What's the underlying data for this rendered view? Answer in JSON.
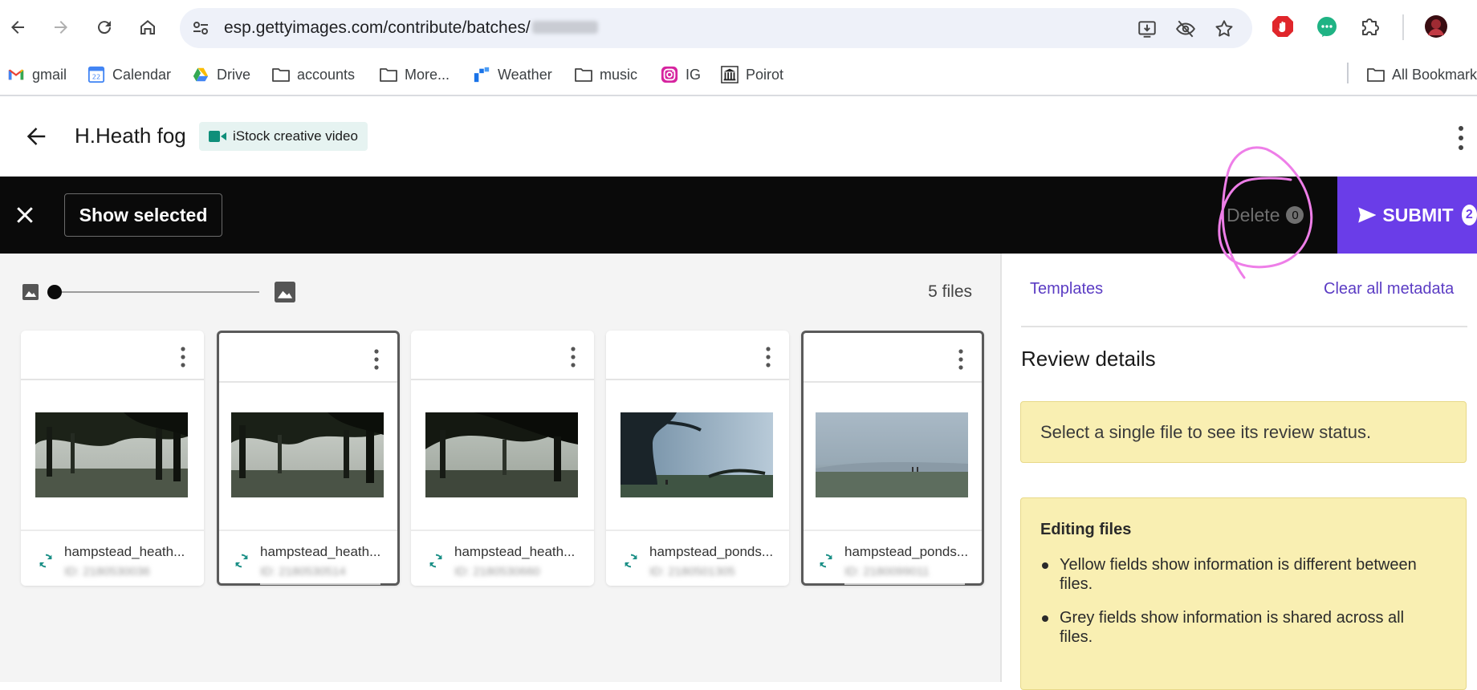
{
  "browser": {
    "url": "esp.gettyimages.com/contribute/batches/",
    "bookmarks": [
      {
        "label": "gmail",
        "icon": "gmail-icon"
      },
      {
        "label": "Calendar",
        "icon": "calendar-icon",
        "badge": "22"
      },
      {
        "label": "Drive",
        "icon": "drive-icon"
      },
      {
        "label": "accounts",
        "icon": "folder-icon"
      },
      {
        "label": "More...",
        "icon": "folder-icon"
      },
      {
        "label": "Weather",
        "icon": "weather-icon"
      },
      {
        "label": "music",
        "icon": "folder-icon"
      },
      {
        "label": "IG",
        "icon": "instagram-icon"
      },
      {
        "label": "Poirot",
        "icon": "museum-icon"
      }
    ],
    "all_bookmarks": "All Bookmarks"
  },
  "header": {
    "title": "H.Heath fog",
    "chip": "iStock creative video"
  },
  "actionbar": {
    "show_selected": "Show selected",
    "delete_label": "Delete",
    "delete_count": "0",
    "submit_label": "SUBMIT",
    "submit_count": "2"
  },
  "gallery": {
    "file_count": "5 files",
    "files": [
      {
        "name": "hampstead_heath...",
        "id": "ID: 2180530036",
        "selected": false
      },
      {
        "name": "hampstead_heath...",
        "id": "ID: 2180530514",
        "selected": true
      },
      {
        "name": "hampstead_heath...",
        "id": "ID: 2180530660",
        "selected": false
      },
      {
        "name": "hampstead_ponds...",
        "id": "ID: 2180501305",
        "selected": false
      },
      {
        "name": "hampstead_ponds...",
        "id": "ID: 2180099011",
        "selected": true
      }
    ]
  },
  "panel": {
    "templates": "Templates",
    "clear_all": "Clear all metadata",
    "review_heading": "Review details",
    "review_message": "Select a single file to see its review status.",
    "editing_title": "Editing files",
    "editing_bullets": [
      "Yellow fields show information is different between files.",
      "Grey fields show information is shared across all files."
    ]
  },
  "colors": {
    "accent": "#6a3de8",
    "link": "#5b3cc4",
    "info_box": "#f9efb2",
    "annotation": "#ee7ee8"
  }
}
